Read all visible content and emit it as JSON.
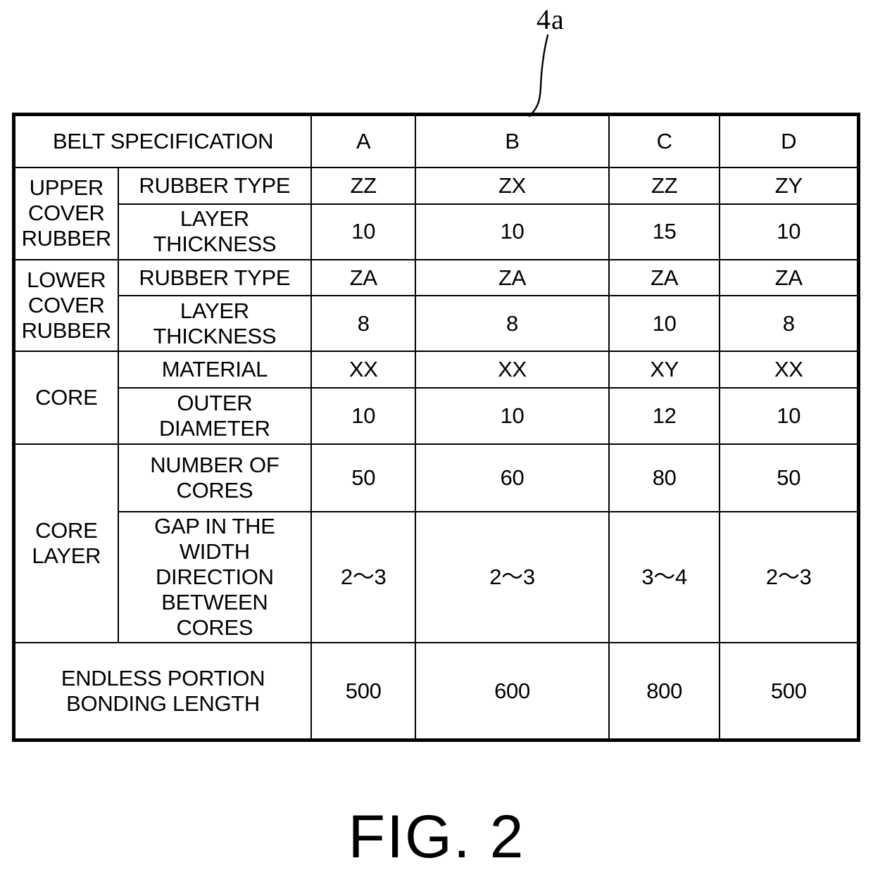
{
  "figure": {
    "caption": "FIG. 2",
    "callout_label": "4a"
  },
  "table": {
    "title_cell": "BELT SPECIFICATION",
    "column_headers": [
      "A",
      "B",
      "C",
      "D"
    ],
    "groups": [
      {
        "label": "UPPER\nCOVER\nRUBBER",
        "label_lines": [
          "UPPER",
          "COVER",
          "RUBBER"
        ],
        "rows": [
          {
            "property": "RUBBER TYPE",
            "values": [
              "ZZ",
              "ZX",
              "ZZ",
              "ZY"
            ]
          },
          {
            "property": "LAYER THICKNESS",
            "values": [
              "10",
              "10",
              "15",
              "10"
            ]
          }
        ]
      },
      {
        "label": "LOWER\nCOVER\nRUBBER",
        "label_lines": [
          "LOWER",
          "COVER",
          "RUBBER"
        ],
        "rows": [
          {
            "property": "RUBBER TYPE",
            "values": [
              "ZA",
              "ZA",
              "ZA",
              "ZA"
            ]
          },
          {
            "property": "LAYER THICKNESS",
            "values": [
              "8",
              "8",
              "10",
              "8"
            ]
          }
        ]
      },
      {
        "label": "CORE",
        "label_lines": [
          "CORE"
        ],
        "rows": [
          {
            "property": "MATERIAL",
            "values": [
              "XX",
              "XX",
              "XY",
              "XX"
            ]
          },
          {
            "property": "OUTER DIAMETER",
            "values": [
              "10",
              "10",
              "12",
              "10"
            ]
          }
        ]
      },
      {
        "label": "CORE\nLAYER",
        "label_lines": [
          "CORE",
          "LAYER"
        ],
        "rows": [
          {
            "property": "NUMBER OF CORES",
            "values": [
              "50",
              "60",
              "80",
              "50"
            ]
          },
          {
            "property": "GAP IN THE WIDTH DIRECTION BETWEEN CORES",
            "property_lines": [
              "GAP IN THE",
              "WIDTH DIRECTION",
              "BETWEEN CORES"
            ],
            "values": [
              "2〜3",
              "2〜3",
              "3〜4",
              "2〜3"
            ]
          }
        ]
      }
    ],
    "footer_row": {
      "property": "ENDLESS PORTION BONDING LENGTH",
      "property_lines": [
        "ENDLESS PORTION",
        "BONDING LENGTH"
      ],
      "values": [
        "500",
        "600",
        "800",
        "500"
      ]
    }
  }
}
